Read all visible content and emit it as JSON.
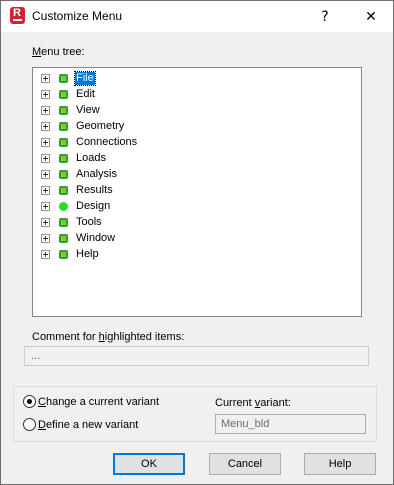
{
  "window": {
    "title": "Customize Menu",
    "help_glyph": "?",
    "close_glyph": "✕",
    "icon": "app-r-icon",
    "icon_letter": "R"
  },
  "menu_tree": {
    "label_first": "M",
    "label_rest": "enu tree:",
    "items": [
      {
        "label": "File",
        "selected": true,
        "icon": "green-square-icon"
      },
      {
        "label": "Edit",
        "icon": "green-square-icon"
      },
      {
        "label": "View",
        "icon": "green-square-icon"
      },
      {
        "label": "Geometry",
        "icon": "green-square-icon"
      },
      {
        "label": "Connections",
        "icon": "green-square-icon"
      },
      {
        "label": "Loads",
        "icon": "green-square-icon"
      },
      {
        "label": "Analysis",
        "icon": "green-square-icon"
      },
      {
        "label": "Results",
        "icon": "green-square-icon"
      },
      {
        "label": "Design",
        "icon": "green-circle-icon"
      },
      {
        "label": "Tools",
        "icon": "green-square-icon"
      },
      {
        "label": "Window",
        "icon": "green-square-icon"
      },
      {
        "label": "Help",
        "icon": "green-square-icon"
      }
    ]
  },
  "comment": {
    "label_pre": "Comment for ",
    "label_ul": "h",
    "label_post": "ighlighted items:",
    "value": "..."
  },
  "variant": {
    "change_pre": "",
    "change_ul": "C",
    "change_post": "hange a current variant",
    "define_pre": "",
    "define_ul": "D",
    "define_post": "efine a new variant",
    "current_label_pre": "Current ",
    "current_label_ul": "v",
    "current_label_post": "ariant:",
    "current_value": "Menu_bld",
    "selected": "change"
  },
  "buttons": {
    "ok": "OK",
    "cancel": "Cancel",
    "help": "Help"
  },
  "colors": {
    "accent": "#0078d7",
    "icon_green": "#3a9a2a",
    "app_icon_red": "#d6202f"
  }
}
